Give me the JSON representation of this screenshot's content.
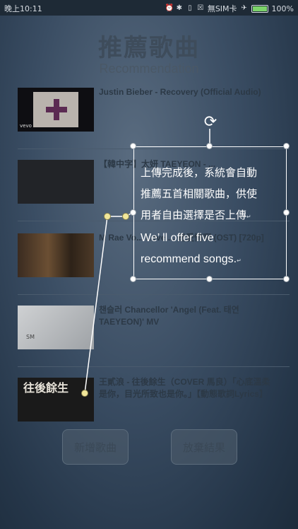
{
  "status_bar": {
    "time": "晚上10:11",
    "sim": "無SIM卡",
    "battery": "100%",
    "battery_level": 1.0,
    "icons": [
      "alarm-icon",
      "bluetooth-icon",
      "vibrate-icon",
      "no-sim-icon",
      "airplane-icon",
      "battery-icon"
    ]
  },
  "header": {
    "title": "推薦歌曲",
    "subtitle": "Recommendation"
  },
  "songs": [
    {
      "title": "Justin Bieber - Recovery (Official Audio)",
      "thumb_text": "vevo"
    },
    {
      "title": "【韓中字】太妍 TAEYEON - ...",
      "thumb_text": ""
    },
    {
      "title": "M Rae Vo... Love ... 是愛情啊 (OST) [720p]",
      "thumb_text": ""
    },
    {
      "title": "챈슬러 Chancellor 'Angel (Feat. 태연 TAEYEON)' MV",
      "thumb_text": "SM"
    },
    {
      "title": "王貳浪 - 往後餘生（COVER 馬良）「心底溫柔是你，目光所致也是你。」【動態歌詞Lyrics】",
      "thumb_text": "往後餘生"
    }
  ],
  "buttons": {
    "add": "新增歌曲",
    "discard": "放棄結果"
  },
  "annotation": {
    "line1": "上傳完成後，系統會自動",
    "line2": "推薦五首相關歌曲，供使",
    "line3": "用者自由選擇是否上傳",
    "line4": "We’  ll offer five",
    "line5": "recommend songs.",
    "return_mark": "↵"
  },
  "colors": {
    "background": "#3a4d63",
    "status_bar": "#1e2a36",
    "annotation": "#ffffff",
    "connector_handle": "#f2e79a",
    "battery": "#7cd36a"
  }
}
